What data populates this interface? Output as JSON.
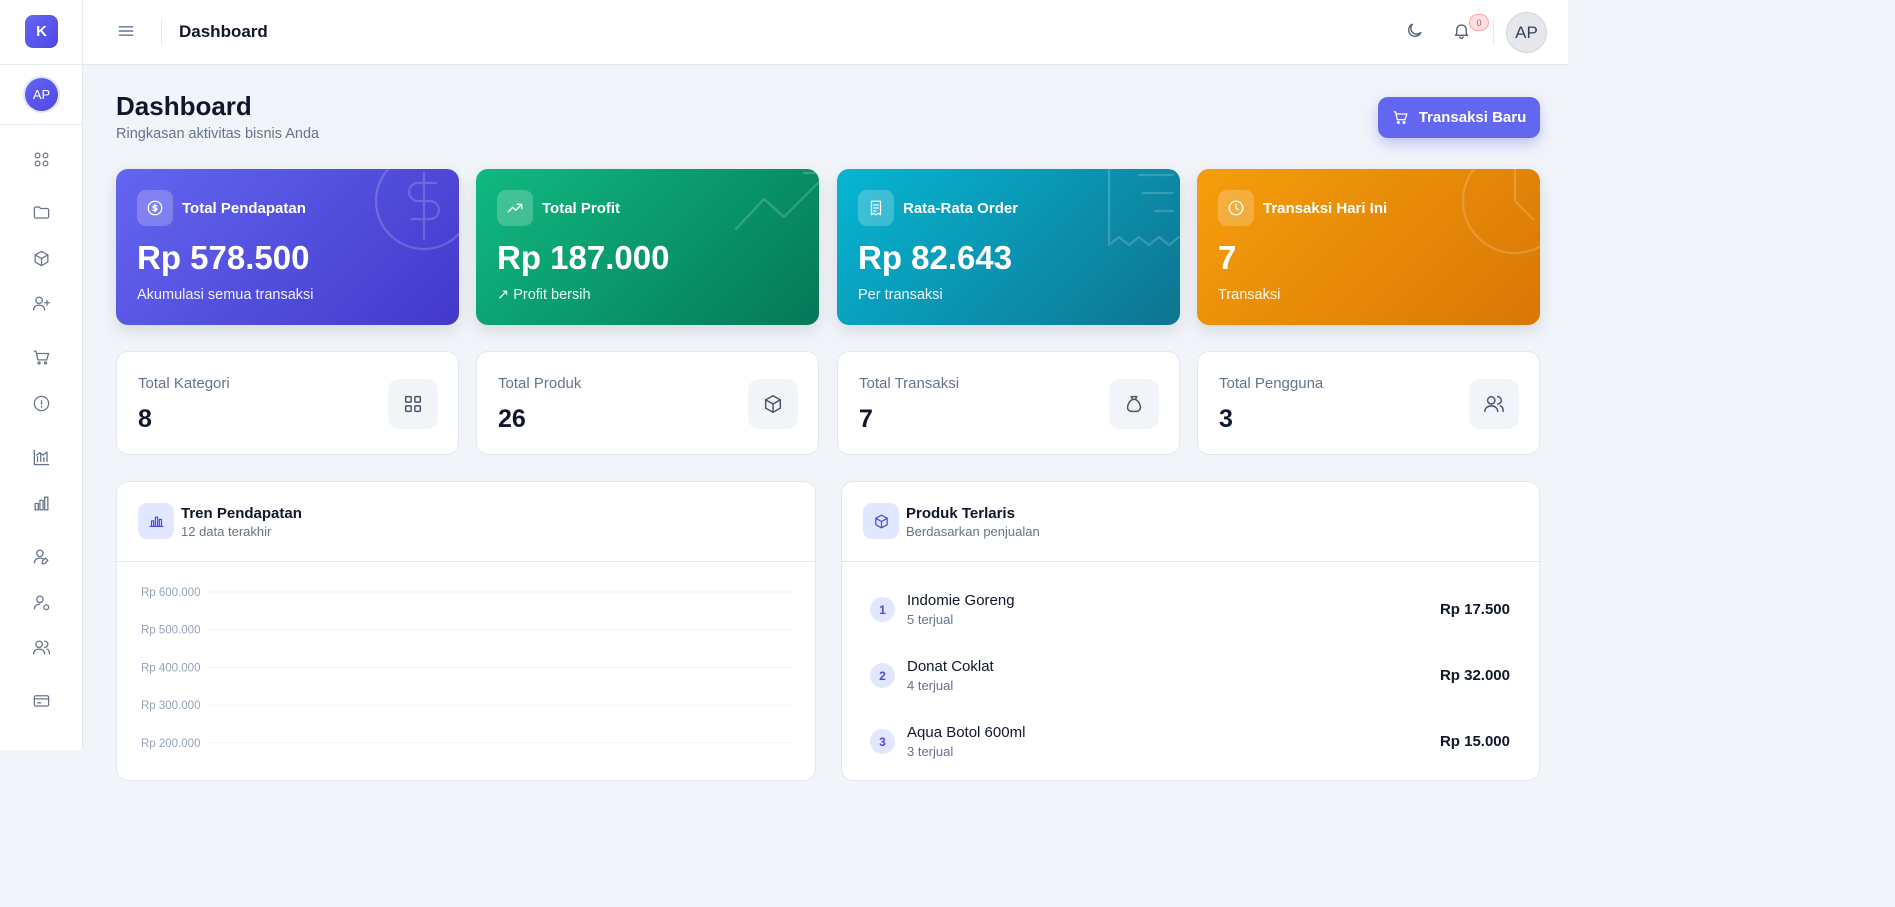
{
  "app": {
    "logo_letter": "K",
    "user_initials": "AP"
  },
  "sidebar": {
    "icons": [
      "dashboard-grid-icon",
      "folder-icon",
      "box-icon",
      "user-plus-icon",
      "cart-icon",
      "info-icon",
      "chart-trend-icon",
      "bar-chart-icon",
      "user-edit-icon",
      "user-settings-icon",
      "users-icon",
      "credit-card-icon"
    ]
  },
  "topbar": {
    "title": "Dashboard",
    "notification_count": "0",
    "avatar_initials": "AP"
  },
  "page": {
    "title": "Dashboard",
    "subtitle": "Ringkasan aktivitas bisnis Anda",
    "new_transaction_label": "Transaksi Baru"
  },
  "summary_cards": [
    {
      "label": "Total Pendapatan",
      "value": "Rp 578.500",
      "sub": "Akumulasi semua transaksi",
      "icon": "dollar-icon",
      "color": "#6366f1"
    },
    {
      "label": "Total Profit",
      "value": "Rp 187.000",
      "sub": "Profit bersih",
      "icon": "trending-up-icon",
      "color": "#10b981"
    },
    {
      "label": "Rata-Rata Order",
      "value": "Rp 82.643",
      "sub": "Per transaksi",
      "icon": "receipt-icon",
      "color": "#06b6d4"
    },
    {
      "label": "Transaksi Hari Ini",
      "value": "7",
      "sub": "Transaksi",
      "icon": "clock-icon",
      "color": "#f59e0b"
    }
  ],
  "stat_cards": [
    {
      "label": "Total Kategori",
      "value": "8",
      "icon": "grid-icon"
    },
    {
      "label": "Total Produk",
      "value": "26",
      "icon": "box-icon"
    },
    {
      "label": "Total Transaksi",
      "value": "7",
      "icon": "money-bag-icon"
    },
    {
      "label": "Total Pengguna",
      "value": "3",
      "icon": "users-icon"
    }
  ],
  "revenue_panel": {
    "title": "Tren Pendapatan",
    "subtitle": "12 data terakhir"
  },
  "chart_data": {
    "type": "line",
    "title": "Tren Pendapatan",
    "y_tick_labels": [
      "Rp 600.000",
      "Rp 500.000",
      "Rp 400.000",
      "Rp 300.000",
      "Rp 200.000"
    ],
    "y_ticks": [
      600000,
      500000,
      400000,
      300000,
      200000
    ],
    "grid": true
  },
  "top_products_panel": {
    "title": "Produk Terlaris",
    "subtitle": "Berdasarkan penjualan",
    "items": [
      {
        "rank": "1",
        "name": "Indomie Goreng",
        "sold": "5 terjual",
        "price": "Rp 17.500"
      },
      {
        "rank": "2",
        "name": "Donat Coklat",
        "sold": "4 terjual",
        "price": "Rp 32.000"
      },
      {
        "rank": "3",
        "name": "Aqua Botol 600ml",
        "sold": "3 terjual",
        "price": "Rp 15.000"
      }
    ]
  }
}
